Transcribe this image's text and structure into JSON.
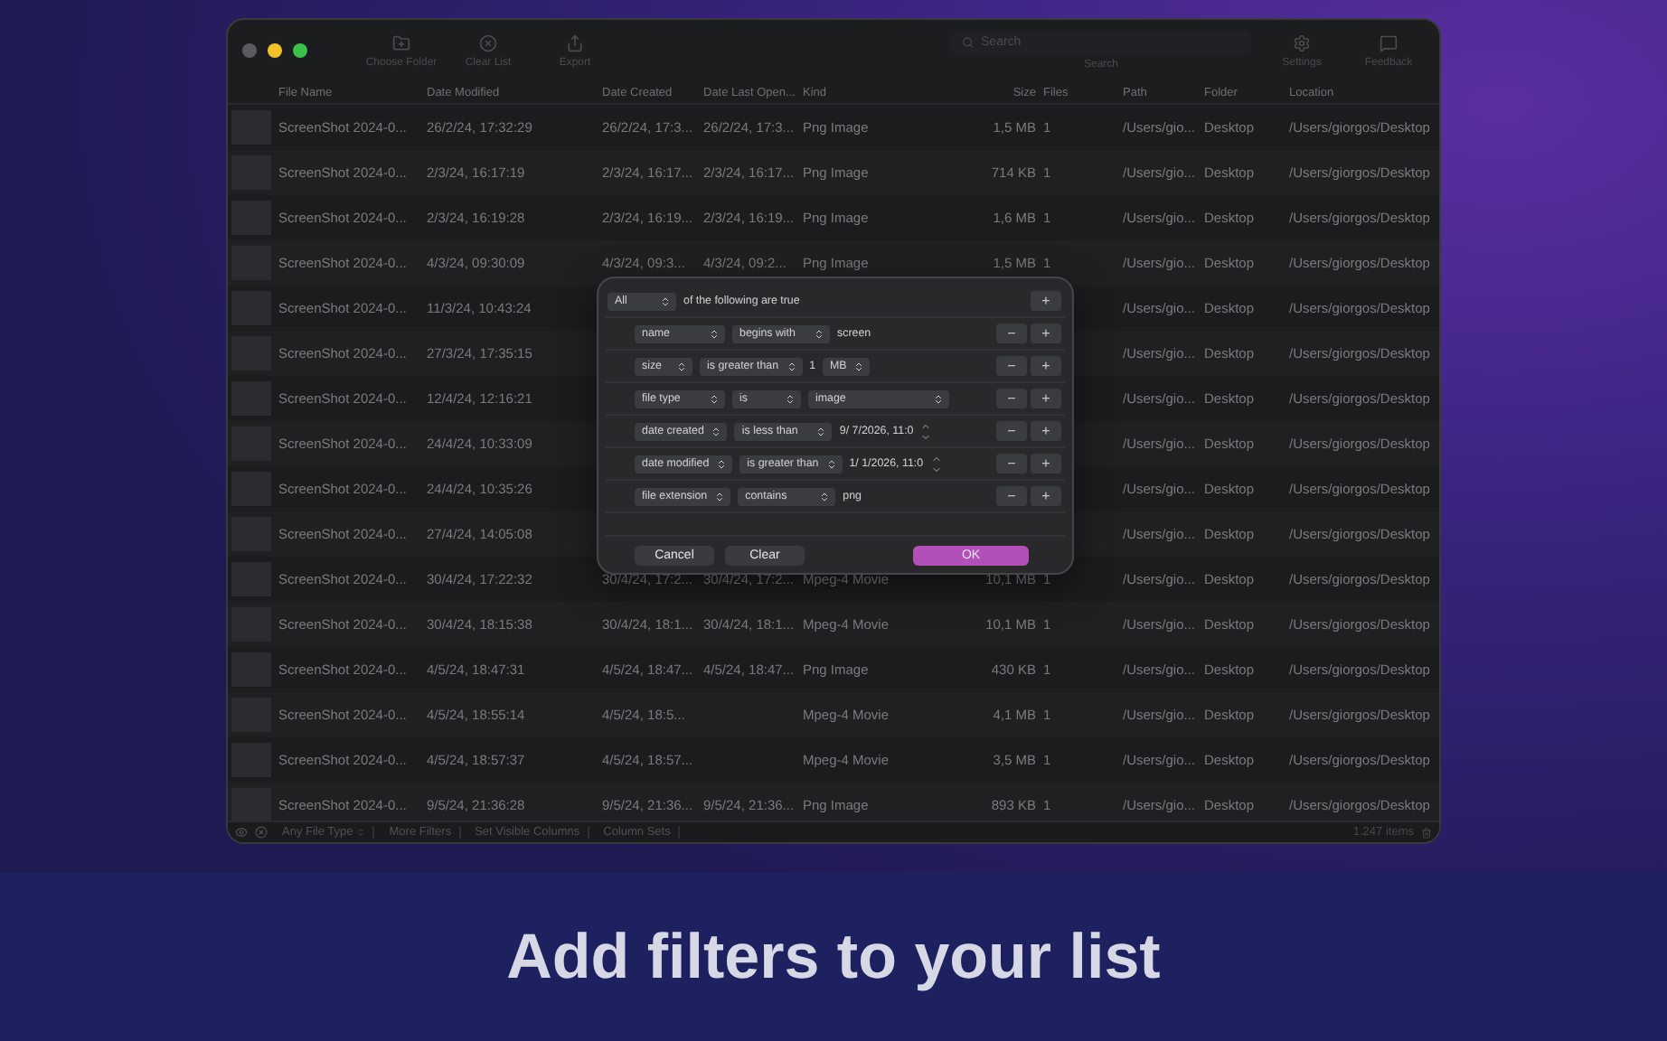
{
  "window": {
    "toolbar": {
      "buttons": [
        {
          "kind": "folder",
          "label": "Choose Folder"
        },
        {
          "kind": "clear",
          "label": "Clear List"
        },
        {
          "kind": "export",
          "label": "Export"
        }
      ],
      "search": {
        "placeholder": "Search",
        "label": "Search"
      },
      "right_buttons": [
        {
          "kind": "settings",
          "label": "Settings"
        },
        {
          "kind": "feedback",
          "label": "Feedback"
        }
      ]
    }
  },
  "table": {
    "columns": [
      "File Name",
      "Date Modified",
      "Date Created",
      "Date Last Open...",
      "Kind",
      "Size",
      "Files",
      "Path",
      "Folder",
      "Location"
    ],
    "rows": [
      {
        "name": "ScreenShot 2024-0...",
        "modified": "26/2/24, 17:32:29",
        "created": "26/2/24, 17:3...",
        "opened": "26/2/24, 17:3...",
        "kind": "Png Image",
        "size": "1,5 MB",
        "files": "1",
        "path": "/Users/gio...",
        "folder": "Desktop",
        "location": "/Users/giorgos/Desktop"
      },
      {
        "name": "ScreenShot 2024-0...",
        "modified": "2/3/24, 16:17:19",
        "created": "2/3/24, 16:17...",
        "opened": "2/3/24, 16:17...",
        "kind": "Png Image",
        "size": "714 KB",
        "files": "1",
        "path": "/Users/gio...",
        "folder": "Desktop",
        "location": "/Users/giorgos/Desktop"
      },
      {
        "name": "ScreenShot 2024-0...",
        "modified": "2/3/24, 16:19:28",
        "created": "2/3/24, 16:19...",
        "opened": "2/3/24, 16:19...",
        "kind": "Png Image",
        "size": "1,6 MB",
        "files": "1",
        "path": "/Users/gio...",
        "folder": "Desktop",
        "location": "/Users/giorgos/Desktop"
      },
      {
        "name": "ScreenShot 2024-0...",
        "modified": "4/3/24, 09:30:09",
        "created": "4/3/24, 09:3...",
        "opened": "4/3/24, 09:2...",
        "kind": "Png Image",
        "size": "1,5 MB",
        "files": "1",
        "path": "/Users/gio...",
        "folder": "Desktop",
        "location": "/Users/giorgos/Desktop"
      },
      {
        "name": "ScreenShot 2024-0...",
        "modified": "11/3/24, 10:43:24",
        "path": "/Users/gio...",
        "folder": "Desktop",
        "location": "/Users/giorgos/Desktop"
      },
      {
        "name": "ScreenShot 2024-0...",
        "modified": "27/3/24, 17:35:15",
        "path": "/Users/gio...",
        "folder": "Desktop",
        "location": "/Users/giorgos/Desktop"
      },
      {
        "name": "ScreenShot 2024-0...",
        "modified": "12/4/24, 12:16:21",
        "path": "/Users/gio...",
        "folder": "Desktop",
        "location": "/Users/giorgos/Desktop"
      },
      {
        "name": "ScreenShot 2024-0...",
        "modified": "24/4/24, 10:33:09",
        "path": "/Users/gio...",
        "folder": "Desktop",
        "location": "/Users/giorgos/Desktop"
      },
      {
        "name": "ScreenShot 2024-0...",
        "modified": "24/4/24, 10:35:26",
        "path": "/Users/gio...",
        "folder": "Desktop",
        "location": "/Users/giorgos/Desktop"
      },
      {
        "name": "ScreenShot 2024-0...",
        "modified": "27/4/24, 14:05:08",
        "path": "/Users/gio...",
        "folder": "Desktop",
        "location": "/Users/giorgos/Desktop"
      },
      {
        "name": "ScreenShot 2024-0...",
        "modified": "30/4/24, 17:22:32",
        "created": "30/4/24, 17:2...",
        "opened": "30/4/24, 17:2...",
        "kind": "Mpeg-4 Movie",
        "size": "10,1 MB",
        "files": "1",
        "path": "/Users/gio...",
        "folder": "Desktop",
        "location": "/Users/giorgos/Desktop"
      },
      {
        "name": "ScreenShot 2024-0...",
        "modified": "30/4/24, 18:15:38",
        "created": "30/4/24, 18:1...",
        "opened": "30/4/24, 18:1...",
        "kind": "Mpeg-4 Movie",
        "size": "10,1 MB",
        "files": "1",
        "path": "/Users/gio...",
        "folder": "Desktop",
        "location": "/Users/giorgos/Desktop"
      },
      {
        "name": "ScreenShot 2024-0...",
        "modified": "4/5/24, 18:47:31",
        "created": "4/5/24, 18:47...",
        "opened": "4/5/24, 18:47...",
        "kind": "Png Image",
        "size": "430 KB",
        "files": "1",
        "path": "/Users/gio...",
        "folder": "Desktop",
        "location": "/Users/giorgos/Desktop"
      },
      {
        "name": "ScreenShot 2024-0...",
        "modified": "4/5/24, 18:55:14",
        "created": "4/5/24, 18:5...",
        "kind": "Mpeg-4 Movie",
        "size": "4,1 MB",
        "files": "1",
        "path": "/Users/gio...",
        "folder": "Desktop",
        "location": "/Users/giorgos/Desktop"
      },
      {
        "name": "ScreenShot 2024-0...",
        "modified": "4/5/24, 18:57:37",
        "created": "4/5/24, 18:57...",
        "kind": "Mpeg-4 Movie",
        "size": "3,5 MB",
        "files": "1",
        "path": "/Users/gio...",
        "folder": "Desktop",
        "location": "/Users/giorgos/Desktop"
      },
      {
        "name": "ScreenShot 2024-0...",
        "modified": "9/5/24, 21:36:28",
        "created": "9/5/24, 21:36...",
        "opened": "9/5/24, 21:36...",
        "kind": "Png Image",
        "size": "893 KB",
        "files": "1",
        "path": "/Users/gio...",
        "folder": "Desktop",
        "location": "/Users/giorgos/Desktop"
      }
    ]
  },
  "status_bar": {
    "file_type": "Any File Type",
    "buttons": [
      "More Filters",
      "Set Visible Columns",
      "Column Sets"
    ],
    "count": "1.247 items"
  },
  "filter_dialog": {
    "match": "All",
    "match_text": "of the following are true",
    "add": "+",
    "rules": [
      {
        "kind": "text",
        "field": "name",
        "operator": "begins with",
        "value": "screen",
        "remove": "−",
        "add": "+"
      },
      {
        "kind": "number_unit",
        "field": "size",
        "operator": "is greater than",
        "value": "1",
        "unit": "MB",
        "remove": "−",
        "add": "+"
      },
      {
        "kind": "select",
        "field": "file type",
        "operator": "is",
        "value": "image",
        "remove": "−",
        "add": "+"
      },
      {
        "kind": "date",
        "field": "date created",
        "operator": "is less than",
        "value": "9/ 7/2026, 11:0",
        "remove": "−",
        "add": "+"
      },
      {
        "kind": "date",
        "field": "date modified",
        "operator": "is greater than",
        "value": "1/ 1/2026, 11:0",
        "remove": "−",
        "add": "+"
      },
      {
        "kind": "text",
        "field": "file extension",
        "operator": "contains",
        "value": "png",
        "remove": "−",
        "add": "+"
      }
    ],
    "buttons": [
      {
        "kind": "secondary",
        "label": "Cancel"
      },
      {
        "kind": "secondary",
        "label": "Clear"
      },
      {
        "kind": "primary",
        "label": "OK"
      }
    ]
  },
  "caption": "Add filters to your list"
}
